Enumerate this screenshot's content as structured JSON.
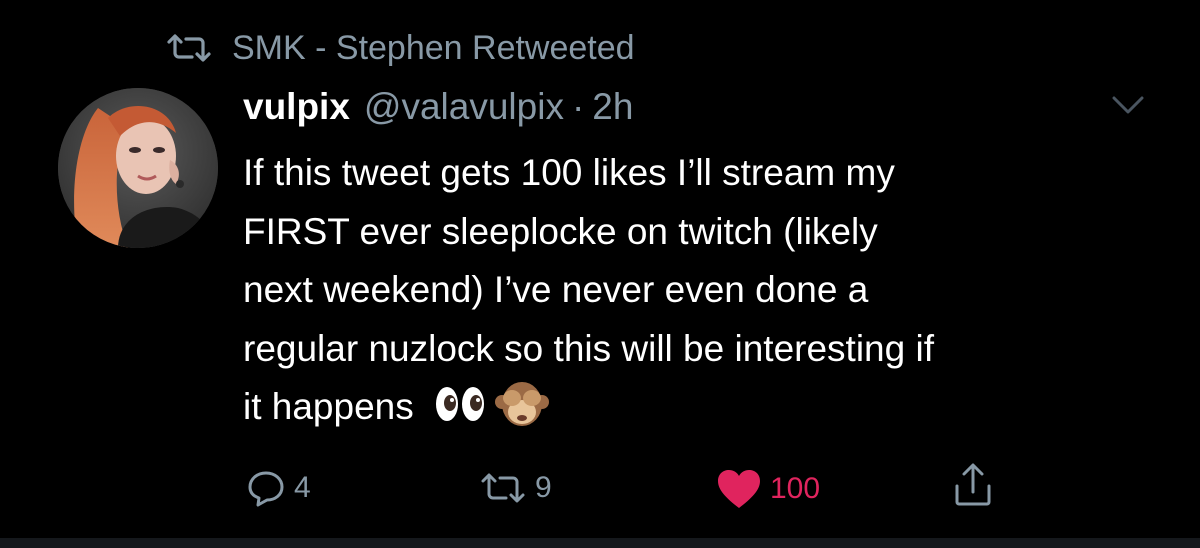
{
  "retweet_context": {
    "icon": "retweet-icon",
    "text": "SMK - Stephen Retweeted"
  },
  "author": {
    "display_name": "vulpix",
    "handle": "@valavulpix",
    "separator": "·",
    "time": "2h",
    "avatar_icon": "avatar"
  },
  "menu": {
    "icon": "chevron-down-icon"
  },
  "tweet": {
    "lines": [
      "If this tweet gets 100 likes I’ll stream my",
      "FIRST ever sleeplocke on twitch (likely",
      "next weekend) I’ve never even done a",
      "regular nuzlock so this will be interesting if",
      "it happens"
    ],
    "emojis": [
      "eyes-emoji",
      "see-no-evil-monkey-emoji"
    ]
  },
  "actions": {
    "reply": {
      "icon": "reply-icon",
      "count": "4"
    },
    "retweet": {
      "icon": "retweet-icon",
      "count": "9"
    },
    "like": {
      "icon": "heart-icon",
      "count": "100",
      "liked": true,
      "color": "#e0245e"
    },
    "share": {
      "icon": "share-icon"
    }
  },
  "colors": {
    "background": "#000000",
    "text": "#ffffff",
    "secondary": "#8899a6",
    "like": "#e0245e"
  }
}
